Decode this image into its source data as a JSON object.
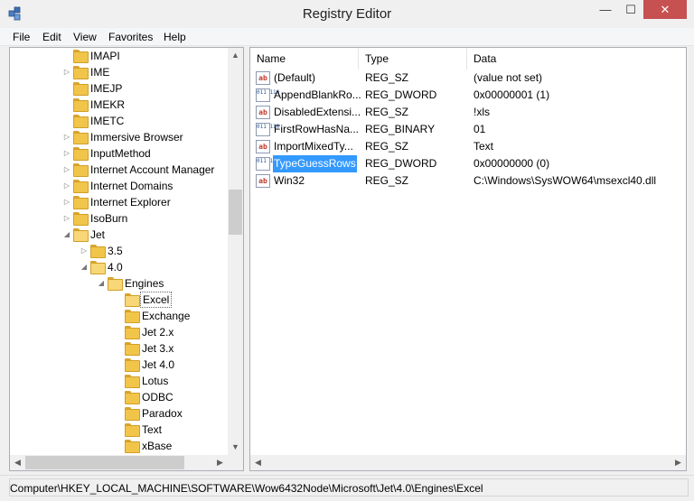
{
  "window": {
    "title": "Registry Editor",
    "minimize": "—",
    "maximize": "☐",
    "close": "✕"
  },
  "menu": [
    "File",
    "Edit",
    "View",
    "Favorites",
    "Help"
  ],
  "tree": [
    {
      "label": "IMAPI",
      "arrow": "",
      "depth": 0
    },
    {
      "label": "IME",
      "arrow": "▷",
      "depth": 0
    },
    {
      "label": "IMEJP",
      "arrow": "",
      "depth": 0
    },
    {
      "label": "IMEKR",
      "arrow": "",
      "depth": 0
    },
    {
      "label": "IMETC",
      "arrow": "",
      "depth": 0
    },
    {
      "label": "Immersive Browser",
      "arrow": "▷",
      "depth": 0
    },
    {
      "label": "InputMethod",
      "arrow": "▷",
      "depth": 0
    },
    {
      "label": "Internet Account Manager",
      "arrow": "▷",
      "depth": 0
    },
    {
      "label": "Internet Domains",
      "arrow": "▷",
      "depth": 0
    },
    {
      "label": "Internet Explorer",
      "arrow": "▷",
      "depth": 0
    },
    {
      "label": "IsoBurn",
      "arrow": "▷",
      "depth": 0
    },
    {
      "label": "Jet",
      "arrow": "◢",
      "depth": 0
    },
    {
      "label": "3.5",
      "arrow": "▷",
      "depth": 1
    },
    {
      "label": "4.0",
      "arrow": "◢",
      "depth": 1
    },
    {
      "label": "Engines",
      "arrow": "◢",
      "depth": 2
    },
    {
      "label": "Excel",
      "arrow": "",
      "depth": 3,
      "selected": true
    },
    {
      "label": "Exchange",
      "arrow": "",
      "depth": 3
    },
    {
      "label": "Jet 2.x",
      "arrow": "",
      "depth": 3
    },
    {
      "label": "Jet 3.x",
      "arrow": "",
      "depth": 3
    },
    {
      "label": "Jet 4.0",
      "arrow": "",
      "depth": 3
    },
    {
      "label": "Lotus",
      "arrow": "",
      "depth": 3
    },
    {
      "label": "ODBC",
      "arrow": "",
      "depth": 3
    },
    {
      "label": "Paradox",
      "arrow": "",
      "depth": 3
    },
    {
      "label": "Text",
      "arrow": "",
      "depth": 3
    },
    {
      "label": "xBase",
      "arrow": "",
      "depth": 3
    }
  ],
  "columns": {
    "name": "Name",
    "type": "Type",
    "data": "Data"
  },
  "values": [
    {
      "icon": "string-value-icon",
      "name": "(Default)",
      "type": "REG_SZ",
      "data": "(value not set)"
    },
    {
      "icon": "binary-value-icon",
      "name": "AppendBlankRo...",
      "type": "REG_DWORD",
      "data": "0x00000001 (1)"
    },
    {
      "icon": "string-value-icon",
      "name": "DisabledExtensi...",
      "type": "REG_SZ",
      "data": "!xls"
    },
    {
      "icon": "binary-value-icon",
      "name": "FirstRowHasNa...",
      "type": "REG_BINARY",
      "data": "01"
    },
    {
      "icon": "string-value-icon",
      "name": "ImportMixedTy...",
      "type": "REG_SZ",
      "data": "Text"
    },
    {
      "icon": "binary-value-icon",
      "name": "TypeGuessRows",
      "type": "REG_DWORD",
      "data": "0x00000000 (0)",
      "selected": true
    },
    {
      "icon": "string-value-icon",
      "name": "Win32",
      "type": "REG_SZ",
      "data": "C:\\Windows\\SysWOW64\\msexcl40.dll"
    }
  ],
  "icons": {
    "string": "ab",
    "binary": "011 110"
  },
  "scroll": {
    "up": "▲",
    "down": "▼",
    "left": "◀",
    "right": "▶"
  },
  "status": "Computer\\HKEY_LOCAL_MACHINE\\SOFTWARE\\Wow6432Node\\Microsoft\\Jet\\4.0\\Engines\\Excel",
  "colors": {
    "selection": "#3399ff",
    "close_button": "#c75050",
    "folder": "#f1c54a"
  }
}
